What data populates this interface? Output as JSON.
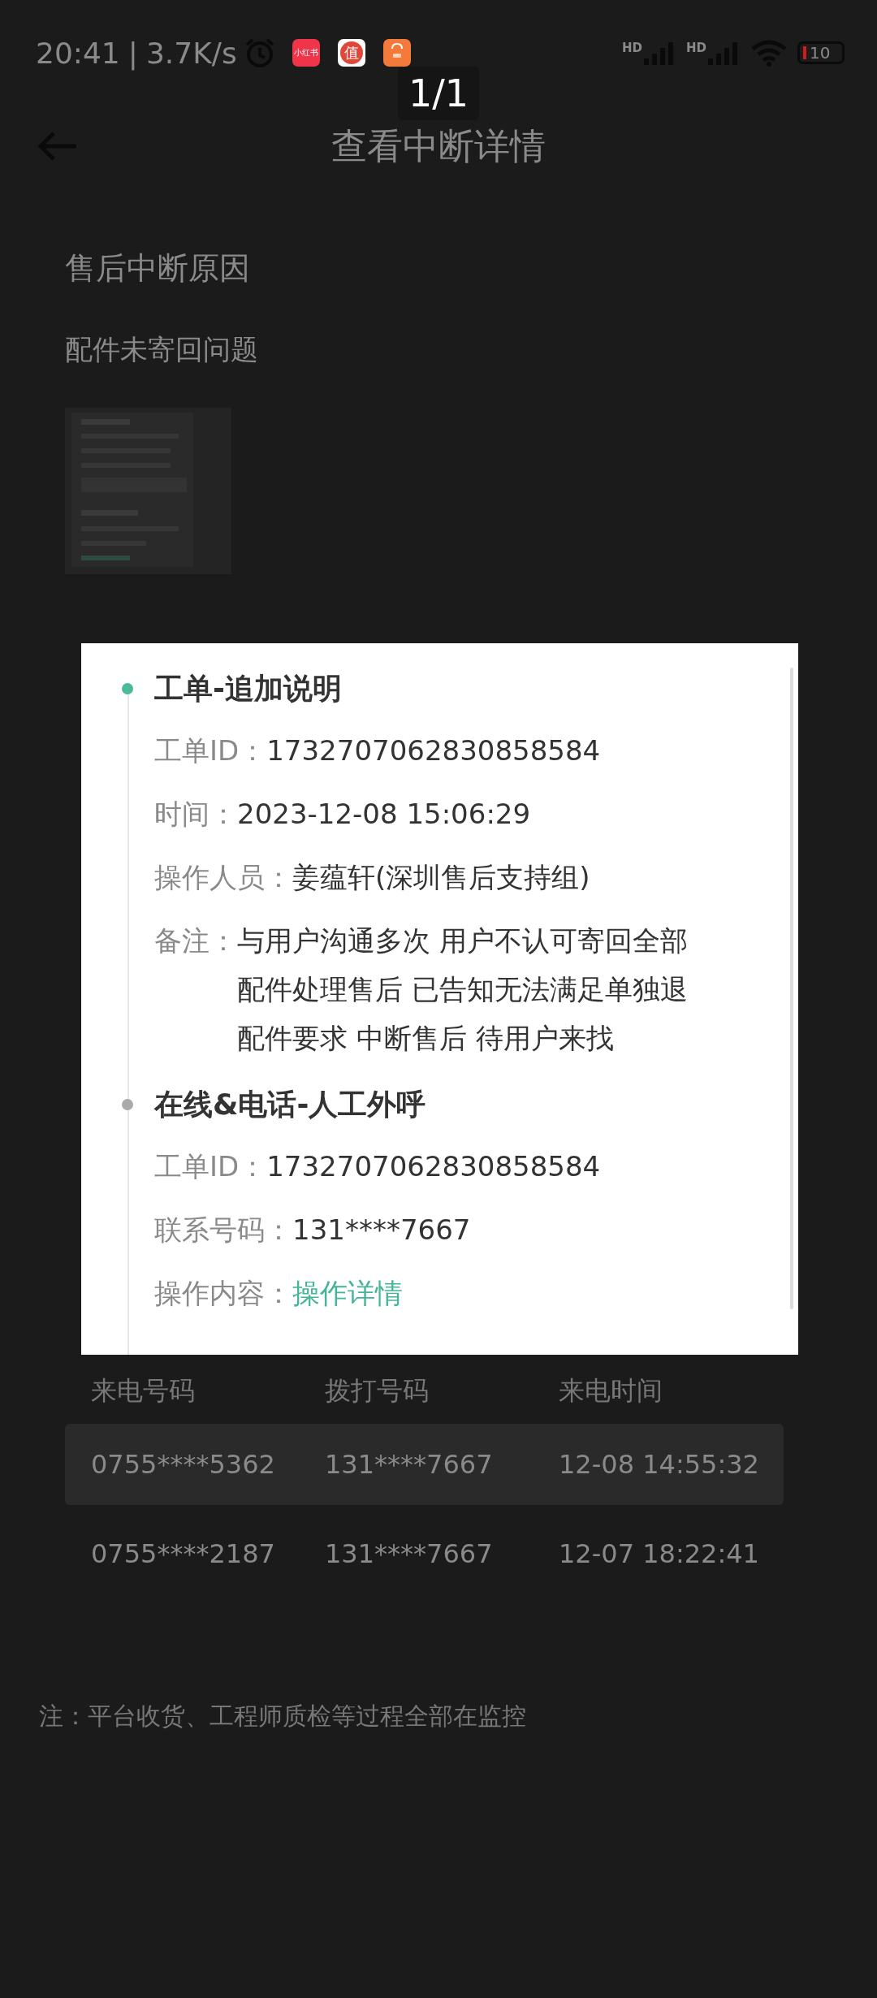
{
  "status_bar": {
    "time": "20:41",
    "separator": "|",
    "speed": "3.7K/s",
    "apps": [
      {
        "kind": "book",
        "label": "小红书"
      },
      {
        "kind": "zhi",
        "label": "值"
      },
      {
        "kind": "bag"
      }
    ],
    "signals": [
      {
        "label": "HD"
      },
      {
        "label": "HD"
      }
    ],
    "battery": "10"
  },
  "header": {
    "title": "查看中断详情"
  },
  "page": {
    "section_title": "售后中断原因",
    "reason": "配件未寄回问题",
    "table": {
      "columns": [
        "来电号码",
        "拨打号码",
        "来电时间"
      ],
      "rows": [
        {
          "highlighted": true,
          "cells": [
            "0755****5362",
            "131****7667",
            "12-08 14:55:32"
          ]
        },
        {
          "highlighted": false,
          "cells": [
            "0755****2187",
            "131****7667",
            "12-07 18:22:41"
          ]
        }
      ]
    },
    "note": "注：平台收货、工程师质检等过程全部在监控"
  },
  "viewer": {
    "counter": "1/1",
    "timeline": [
      {
        "title": "工单-追加说明",
        "color": "#4db89a",
        "fields": [
          {
            "kind": "text",
            "label": "工单ID：",
            "value": "1732707062830858584"
          },
          {
            "kind": "text",
            "label": "时间：",
            "value": "2023-12-08 15:06:29"
          },
          {
            "kind": "text",
            "label": "操作人员：",
            "value": "姜蕴轩(深圳售后支持组)"
          },
          {
            "kind": "text",
            "label": "备注：",
            "value": "与用户沟通多次 用户不认可寄回全部配件处理售后 已告知无法满足单独退配件要求 中断售后 待用户来找"
          }
        ]
      },
      {
        "title": "在线&电话-人工外呼",
        "color": "#aaaaaa",
        "fields": [
          {
            "kind": "text",
            "label": "工单ID：",
            "value": "1732707062830858584"
          },
          {
            "kind": "text",
            "label": "联系号码：",
            "value": "131****7667"
          },
          {
            "kind": "link",
            "label": "操作内容：",
            "value": "操作详情"
          }
        ]
      }
    ]
  }
}
